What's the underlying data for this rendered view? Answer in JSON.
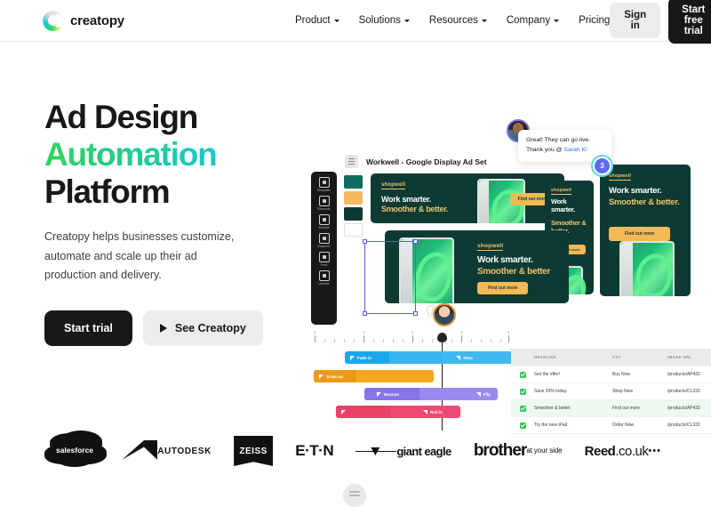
{
  "nav": {
    "brand_name": "creatopy",
    "links": [
      {
        "label": "Product",
        "has_caret": true
      },
      {
        "label": "Solutions",
        "has_caret": true
      },
      {
        "label": "Resources",
        "has_caret": true
      },
      {
        "label": "Company",
        "has_caret": true
      },
      {
        "label": "Pricing",
        "has_caret": false
      }
    ],
    "signin_label": "Sign in",
    "trial_label": "Start free trial"
  },
  "hero": {
    "headline_line1": "Ad Design",
    "headline_line2": "Automation",
    "headline_line3": "Platform",
    "subhead": "Creatopy helps businesses customize, automate and scale up their ad production and delivery.",
    "primary_cta": "Start trial",
    "secondary_cta": "See Creatopy",
    "accent_gradient_start": "#33d35e",
    "accent_gradient_end": "#1ec8cf"
  },
  "editor": {
    "document_title": "Workwell - Google Display Ad Set",
    "rail_items": [
      {
        "label": "Templates"
      },
      {
        "label": "Elements"
      },
      {
        "label": "Animate"
      },
      {
        "label": "Brand Kit"
      },
      {
        "label": "Feed"
      },
      {
        "label": "Uploads"
      }
    ],
    "swatches": [
      "#106a60",
      "#f5b95e",
      "#0d3b33",
      "#ffffff"
    ],
    "comment": {
      "text_line1": "Great! They can go live.",
      "text_line2_prefix": "Thank you @ ",
      "mention": "Sarah K!",
      "badge_count": "3"
    },
    "ads": {
      "brand": "shopwell",
      "headline_1": "Work smarter.",
      "headline_2": "Smoother & better.",
      "headline_2_short": "Smoother & better",
      "cta": "Find out more"
    }
  },
  "timeline": {
    "ruler_numbers": [
      "0",
      "1",
      "2",
      "3",
      "4"
    ],
    "tracks": [
      {
        "name": "Fade in",
        "end_name": "Slow",
        "color": "#37b6f0"
      },
      {
        "name": "Scale up",
        "end_name": "",
        "color": "#f5a623"
      },
      {
        "name": "Bounce",
        "end_name": "Flip",
        "color": "#9b8af0"
      },
      {
        "name": "",
        "end_name": "Roll in",
        "color": "#f04a73"
      }
    ]
  },
  "table": {
    "columns": [
      "HEADLINE",
      "CTA",
      "IMAGE URL"
    ],
    "rows": [
      {
        "checked": true,
        "headline": "Get the offer!",
        "cta": "Buy Now",
        "url": "/products/AP432",
        "highlight": false
      },
      {
        "checked": true,
        "headline": "Save 50% today.",
        "cta": "Shop Now",
        "url": "/products/CL332",
        "highlight": false
      },
      {
        "checked": true,
        "headline": "Smoother & better.",
        "cta": "Find out more",
        "url": "/products/AP432",
        "highlight": true
      },
      {
        "checked": true,
        "headline": "Try the new iPad.",
        "cta": "Order Now",
        "url": "/products/CL332",
        "highlight": false
      }
    ]
  },
  "logos": [
    {
      "name": "salesforce",
      "label": "salesforce"
    },
    {
      "name": "autodesk",
      "label": "AUTODESK"
    },
    {
      "name": "zeiss",
      "label": "ZEISS"
    },
    {
      "name": "eaton",
      "label": "E·T·N"
    },
    {
      "name": "giant-eagle",
      "label": "giant eagle"
    },
    {
      "name": "brother",
      "label": "brother",
      "tagline": "at your side"
    },
    {
      "name": "reed",
      "label": "Reed",
      "suffix": ".co.uk"
    }
  ]
}
